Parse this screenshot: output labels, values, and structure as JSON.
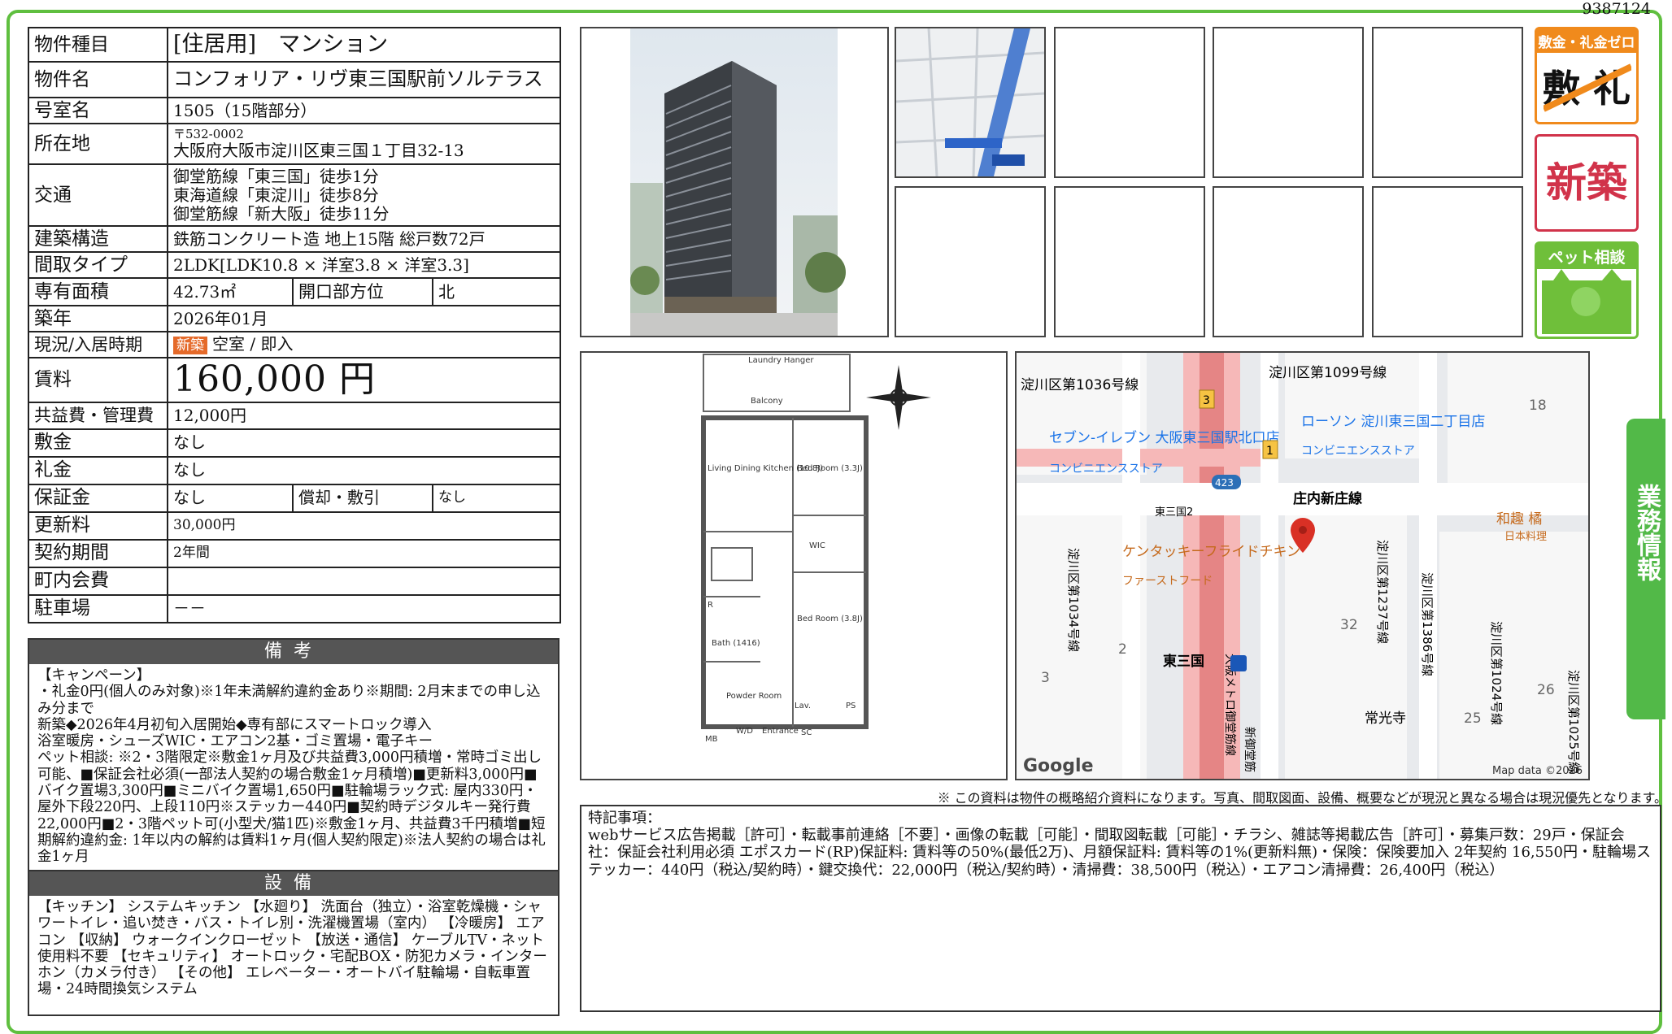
{
  "doc_id": "9387124",
  "info_rows": {
    "type": {
      "label": "物件種目",
      "value": "[住居用]　マンション"
    },
    "name": {
      "label": "物件名",
      "value": "コンフォリア・リヴ東三国駅前ソルテラス"
    },
    "room": {
      "label": "号室名",
      "value": "1505（15階部分）"
    },
    "address": {
      "label": "所在地",
      "postal": "〒532-0002",
      "value": "大阪府大阪市淀川区東三国１丁目32-13"
    },
    "access": {
      "label": "交通",
      "lines": [
        "御堂筋線「東三国」徒歩1分",
        "東海道線「東淀川」徒歩8分",
        "御堂筋線「新大阪」徒歩11分"
      ]
    },
    "structure": {
      "label": "建築構造",
      "value": "鉄筋コンクリート造 地上15階 総戸数72戸"
    },
    "layout": {
      "label": "間取タイプ",
      "value": "2LDK[LDK10.8 × 洋室3.8 × 洋室3.3]"
    },
    "area": {
      "label": "専有面積",
      "value": "42.73㎡",
      "label2": "開口部方位",
      "value2": "北"
    },
    "built": {
      "label": "築年",
      "value": "2026年01月"
    },
    "status": {
      "label": "現況/入居時期",
      "badge": "新築",
      "value": "空室 / 即入"
    },
    "rent": {
      "label": "賃料",
      "value": "160,000 円"
    },
    "fee": {
      "label": "共益費・管理費",
      "value": "12,000円"
    },
    "deposit": {
      "label": "敷金",
      "value": "なし"
    },
    "key_money": {
      "label": "礼金",
      "value": "なし"
    },
    "guarantee": {
      "label": "保証金",
      "value": "なし",
      "label2": "償却・敷引",
      "value2": "なし"
    },
    "renewal": {
      "label": "更新料",
      "value": "30,000円"
    },
    "contract": {
      "label": "契約期間",
      "value": "2年間"
    },
    "community": {
      "label": "町内会費",
      "value": ""
    },
    "parking": {
      "label": "駐車場",
      "value": "－－"
    }
  },
  "remarks": {
    "title": "備考",
    "lines": [
      "【キャンペーン】",
      "・礼金0円(個人のみ対象)※1年未満解約違約金あり※期間: 2月末までの申し込み分まで",
      "新築◆2026年4月初旬入居開始◆専有部にスマートロック導入",
      "浴室暖房・シューズWIC・エアコン2基・ゴミ置場・電子キー",
      "ペット相談: ※2・3階限定※敷金1ヶ月及び共益費3,000円積増・常時ゴミ出し可能、■保証会社必須(一部法人契約の場合敷金1ヶ月積増)■更新料3,000円■バイク置場3,300円■ミニバイク置場1,650円■駐輪場ラック式: 屋内330円・屋外下段220円、上段110円※ステッカー440円■契約時デジタルキー発行費22,000円■2・3階ペット可(小型犬/猫1匹)※敷金1ヶ月、共益費3千円積増■短期解約違約金: 1年以内の解約は賃料1ヶ月(個人契約限定)※法人契約の場合は礼金1ヶ月"
    ]
  },
  "equipment": {
    "title": "設備",
    "text": "【キッチン】 システムキッチン 【水廻り】 洗面台（独立）・浴室乾燥機・シャワートイレ・追い焚き・バス・トイレ別・洗濯機置場（室内） 【冷暖房】 エアコン 【収納】 ウォークインクローゼット 【放送・通信】 ケーブルTV・ネット使用料不要 【セキュリティ】 オートロック・宅配BOX・防犯カメラ・インターホン（カメラ付き） 【その他】 エレベーター・オートバイ駐輪場・自転車置場・24時間換気システム"
  },
  "floorplan": {
    "rooms": [
      "Laundry Hanger",
      "Balcony",
      "Living Dining Kitchen (10.8J)",
      "Bed Room (3.3J)",
      "WIC",
      "Bed Room (3.8J)",
      "R",
      "Bath (1416)",
      "Powder Room",
      "Lav.",
      "PS",
      "W/D",
      "Entrance",
      "SC",
      "MB"
    ]
  },
  "map": {
    "labels": [
      "淀川区第1036号線",
      "淀川区第1099号線",
      "セブン-イレブン 大阪東三国駅北口店",
      "コンビニエンスストア",
      "ローソン 淀川東三国二丁目店",
      "コンビニエンスストア",
      "庄内新庄線",
      "和趣 橘",
      "日本料理",
      "ケンタッキーフライドチキン",
      "ファーストフード",
      "東三国2",
      "東三国",
      "常光寺",
      "淀川区第1034号線",
      "淀川区第1237号線",
      "淀川区第1386号線",
      "淀川区第1024号線",
      "淀川区第1025号線",
      "大阪メトロ御堂筋線",
      "新御堂筋"
    ],
    "numbers": [
      "18",
      "2",
      "3",
      "32",
      "25",
      "26"
    ],
    "route_badges": [
      "3",
      "1",
      "423"
    ],
    "google": "Google",
    "copyright": "Map data ©2026"
  },
  "badges": {
    "zero": {
      "title": "敷金・礼金ゼロ",
      "kanji": "敷 礼",
      "color": "#f08a1c"
    },
    "new": {
      "title": "新築",
      "color": "#d1334a"
    },
    "pet": {
      "title": "ペット相談",
      "color": "#6fbf3a"
    }
  },
  "side_tab": {
    "label": "業務情報",
    "color": "#52b948"
  },
  "disclaimer": "※ この資料は物件の概略紹介資料になります。写真、間取図面、設備、概要などが現況と異なる場合は現況優先となります。",
  "special": {
    "title": "特記事項：",
    "text": "webサービス広告掲載［許可］・転載事前連絡［不要］・画像の転載［可能］・間取図転載［可能］・チラシ、雑誌等掲載広告［許可］・募集戸数：29戸・保証会社：保証会社利用必須 エポスカード(RP)保証料: 賃料等の50%(最低2万)、月額保証料: 賃料等の1%(更新料無)・保険：保険要加入 2年契約 16,550円・駐輪場ステッカー：440円（税込/契約時）・鍵交換代：22,000円（税込/契約時）・清掃費：38,500円（税込）・エアコン清掃費：26,400円（税込）"
  }
}
